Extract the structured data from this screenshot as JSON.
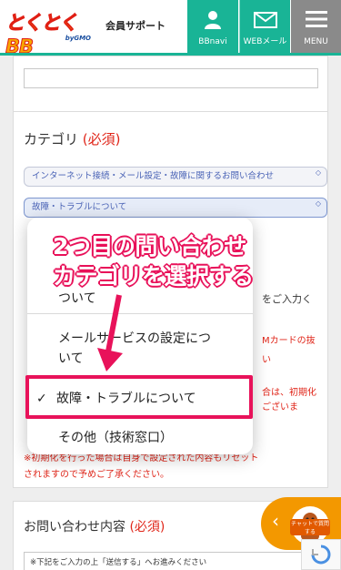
{
  "header": {
    "logo": "とくとくBB",
    "logo_sub": "byGMO",
    "title": "会員サポート",
    "nav": [
      {
        "label": "BBnavi",
        "icon": "person-icon"
      },
      {
        "label": "WEBメール",
        "icon": "mail-icon"
      },
      {
        "label": "MENU",
        "icon": "hamburger-icon"
      }
    ]
  },
  "form": {
    "category_title": "カテゴリ",
    "required_mark": "(必須)",
    "category_select_1": "インターネット接続・メール設定・故障に関するお問い合わせ",
    "category_select_2": "故障・トラブルについて",
    "background_texts": {
      "line_a": "をご入力く",
      "line_b": "Mカードの抜",
      "line_c": "い",
      "line_d": "合は、初期化",
      "line_e": "ございま",
      "warning_1": "※初期化を行った場合は自身で設定された内容もリセット",
      "warning_2": "されますので予めご了承ください。"
    },
    "inquiry_title": "お問い合わせ内容",
    "inquiry_required": "(必須)",
    "inquiry_notice": "※下記をご入力の上「送信する」へお進みください"
  },
  "dropdown": {
    "options": [
      {
        "label": "ついて",
        "selected": false
      },
      {
        "label": "メールサービスの設定につ",
        "label2": "いて",
        "selected": false
      },
      {
        "label": "故障・トラブルについて",
        "selected": true
      },
      {
        "label": "その他（技術窓口）",
        "selected": false
      }
    ],
    "check_mark": "✓"
  },
  "annotation": {
    "line1": "2つ目の問い合わせ",
    "line2": "カテゴリを選択する",
    "color": "#e8125a"
  },
  "chat": {
    "label": "チャットで質問する"
  },
  "colors": {
    "brand_teal": "#19b496",
    "menu_gray": "#8a8a8a",
    "required_red": "#e0261a",
    "chat_orange": "#f39800"
  }
}
